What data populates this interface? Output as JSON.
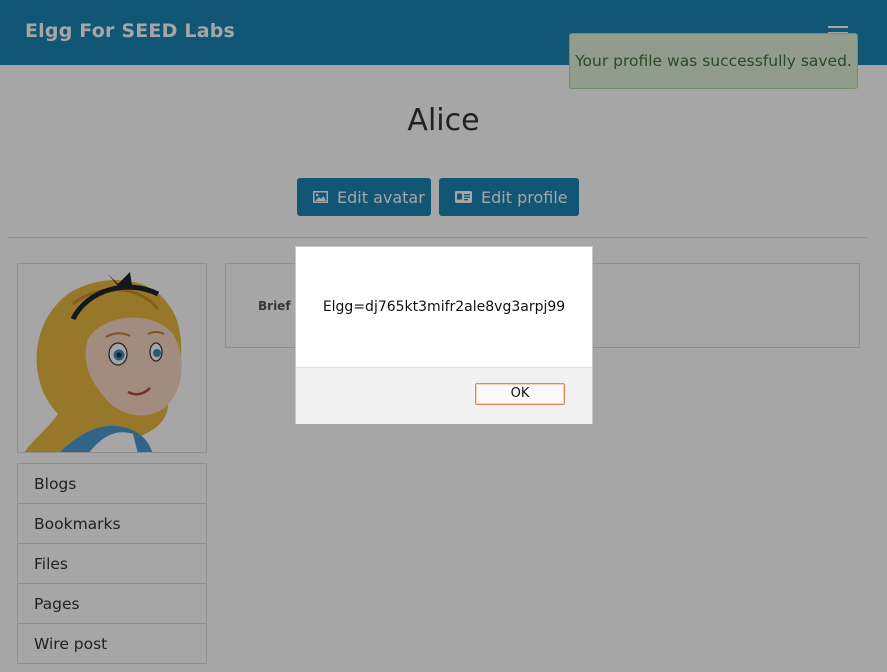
{
  "header": {
    "site_title": "Elgg For SEED Labs",
    "menu_icon": "hamburger-menu-icon"
  },
  "flash_message": "Your profile was successfully saved.",
  "profile": {
    "name": "Alice",
    "buttons": {
      "edit_avatar": "Edit avatar",
      "edit_profile": "Edit profile"
    },
    "details_label": "Brief description"
  },
  "owner_menu": [
    {
      "label": "Blogs"
    },
    {
      "label": "Bookmarks"
    },
    {
      "label": "Files"
    },
    {
      "label": "Pages"
    },
    {
      "label": "Wire post"
    }
  ],
  "alert": {
    "message": "Elgg=dj765kt3mifr2ale8vg3arpj99",
    "ok_label": "OK"
  },
  "colors": {
    "brand": "#1b84b4",
    "success_bg": "#dff0d8",
    "success_text": "#3c763d"
  }
}
